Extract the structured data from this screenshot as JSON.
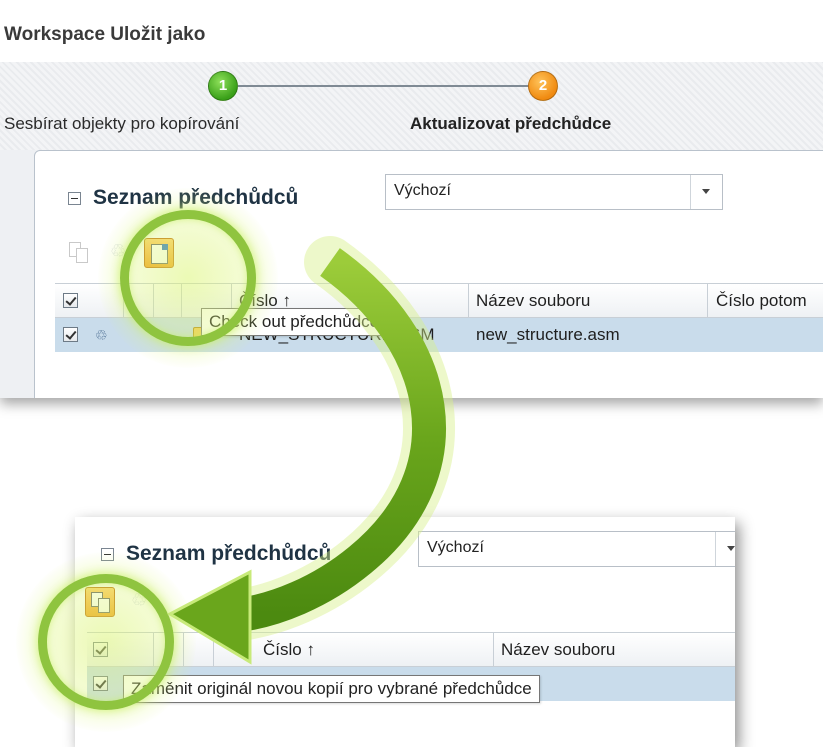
{
  "dialog": {
    "title": "Workspace Uložit jako",
    "steps": [
      {
        "number": "1",
        "label": "Sesbírat objekty pro kopírování"
      },
      {
        "number": "2",
        "label": "Aktualizovat předchůdce"
      }
    ]
  },
  "top_panel": {
    "section_title": "Seznam předchůdců",
    "view_select_value": "Výchozí",
    "columns": [
      "Číslo ↑",
      "Název souboru",
      "Číslo potom"
    ],
    "row": {
      "number": "NEW_STRUCTURE.ASM",
      "filename": "new_structure.asm"
    },
    "tooltip": "Check out předchůdce",
    "toolbar_icons": [
      "replace-copy-icon",
      "recycle-icon",
      "check-out-icon"
    ]
  },
  "bottom_panel": {
    "section_title": "Seznam předchůdců",
    "view_select_value": "Výchozí",
    "columns": [
      "Číslo ↑",
      "Název souboru"
    ],
    "tooltip": "Zaměnit originál novou kopií pro vybrané předchůdce",
    "toolbar_icons": [
      "replace-copy-icon",
      "recycle-icon"
    ]
  },
  "colors": {
    "highlight_ring": "#8fc43f",
    "arrow_green": "#6aa61c",
    "selected_row": "#c9dceb",
    "active_button": "#f4a020",
    "step1_green": "#3aa019",
    "step2_orange": "#f08a10"
  }
}
